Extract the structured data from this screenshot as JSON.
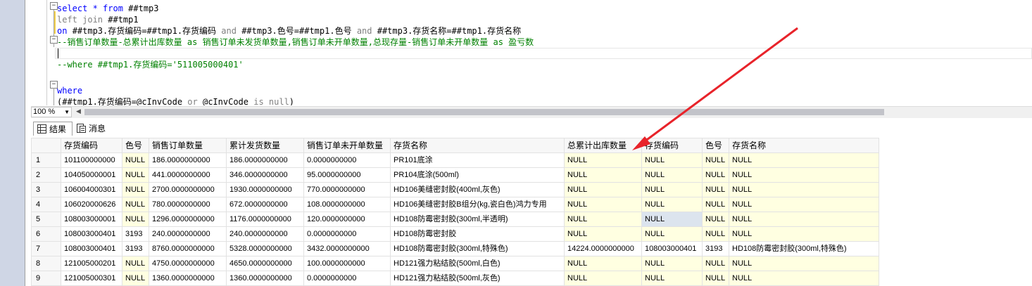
{
  "editor": {
    "lines": [
      {
        "segments": [
          {
            "t": "select * ",
            "c": "kw"
          },
          {
            "t": "from ",
            "c": "kw"
          },
          {
            "t": "##tmp3",
            "c": ""
          }
        ]
      },
      {
        "segments": [
          {
            "t": "left join ",
            "c": "gr"
          },
          {
            "t": "##tmp1",
            "c": ""
          }
        ]
      },
      {
        "segments": [
          {
            "t": "on ",
            "c": "kw"
          },
          {
            "t": "##tmp3.存货编码=##tmp1.存货编码 ",
            "c": ""
          },
          {
            "t": "and ",
            "c": "gr"
          },
          {
            "t": "##tmp3.色号=##tmp1.色号 ",
            "c": ""
          },
          {
            "t": "and ",
            "c": "gr"
          },
          {
            "t": "##tmp3.存货名称=##tmp1.存货名称",
            "c": ""
          }
        ]
      },
      {
        "segments": [
          {
            "t": "--销售订单数量-总累计出库数量 as 销售订单未发货单数量,销售订单未开单数量,总现存量-销售订单未开单数量 as 盈亏数",
            "c": "cm"
          }
        ]
      },
      {
        "segments": [
          {
            "t": "",
            "c": ""
          }
        ]
      },
      {
        "segments": [
          {
            "t": "--where ##tmp1.存货编码='511005000401'",
            "c": "cm"
          }
        ]
      },
      {
        "segments": [
          {
            "t": "",
            "c": ""
          }
        ]
      },
      {
        "segments": [
          {
            "t": "where",
            "c": "kw"
          }
        ]
      },
      {
        "segments": [
          {
            "t": "(##tmp1.存货编码=@cInvCode ",
            "c": ""
          },
          {
            "t": "or ",
            "c": "gr"
          },
          {
            "t": "@cInvCode ",
            "c": ""
          },
          {
            "t": "is null",
            "c": "gr"
          },
          {
            "t": ")",
            "c": ""
          }
        ]
      }
    ]
  },
  "zoom": {
    "value": "100 %"
  },
  "tabs": {
    "results": "结果",
    "messages": "消息"
  },
  "grid": {
    "columns": [
      "存货编码",
      "色号",
      "销售订单数量",
      "累计发货数量",
      "销售订单未开单数量",
      "存货名称",
      "总累计出库数量",
      "存货编码",
      "色号",
      "存货名称"
    ],
    "rows": [
      {
        "n": "1",
        "cells": [
          "101100000000",
          "NULL",
          "186.0000000000",
          "186.0000000000",
          "0.0000000000",
          "PR101底涂",
          "NULL",
          "NULL",
          "NULL",
          "NULL"
        ]
      },
      {
        "n": "2",
        "cells": [
          "104050000001",
          "NULL",
          "441.0000000000",
          "346.0000000000",
          "95.0000000000",
          "PR104底涂(500ml)",
          "NULL",
          "NULL",
          "NULL",
          "NULL"
        ]
      },
      {
        "n": "3",
        "cells": [
          "106004000301",
          "NULL",
          "2700.0000000000",
          "1930.0000000000",
          "770.0000000000",
          "HD106美缝密封胶(400ml,灰色)",
          "NULL",
          "NULL",
          "NULL",
          "NULL"
        ]
      },
      {
        "n": "4",
        "cells": [
          "106020000626",
          "NULL",
          "780.0000000000",
          "672.0000000000",
          "108.0000000000",
          "HD106美缝密封胶B组分(kg,瓷白色)鸿力专用",
          "NULL",
          "NULL",
          "NULL",
          "NULL"
        ]
      },
      {
        "n": "5",
        "cells": [
          "108003000001",
          "NULL",
          "1296.0000000000",
          "1176.0000000000",
          "120.0000000000",
          "HD108防霉密封胶(300ml,半透明)",
          "NULL",
          "NULL",
          "NULL",
          "NULL"
        ]
      },
      {
        "n": "6",
        "cells": [
          "108003000401",
          "3193",
          "240.0000000000",
          "240.0000000000",
          "0.0000000000",
          "HD108防霉密封胶",
          "NULL",
          "NULL",
          "NULL",
          "NULL"
        ]
      },
      {
        "n": "7",
        "cells": [
          "108003000401",
          "3193",
          "8760.0000000000",
          "5328.0000000000",
          "3432.0000000000",
          "HD108防霉密封胶(300ml,特殊色)",
          "14224.0000000000",
          "108003000401",
          "3193",
          "HD108防霉密封胶(300ml,特殊色)"
        ]
      },
      {
        "n": "8",
        "cells": [
          "121005000201",
          "NULL",
          "4750.0000000000",
          "4650.0000000000",
          "100.0000000000",
          "HD121强力粘结胶(500ml,白色)",
          "NULL",
          "NULL",
          "NULL",
          "NULL"
        ]
      },
      {
        "n": "9",
        "cells": [
          "121005000301",
          "NULL",
          "1360.0000000000",
          "1360.0000000000",
          "0.0000000000",
          "HD121强力粘结胶(500ml,灰色)",
          "NULL",
          "NULL",
          "NULL",
          "NULL"
        ]
      }
    ]
  },
  "colors": {
    "null_bg": "#ffffe1",
    "keyword": "#0000ff",
    "comment": "#008000",
    "arrow": "#e8232a"
  }
}
